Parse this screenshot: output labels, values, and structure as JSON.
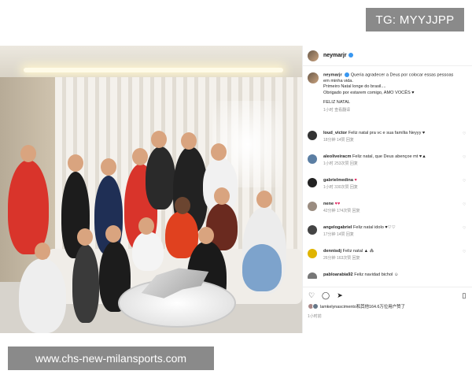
{
  "badges": {
    "tg": "TG: MYYJJPP",
    "watermark": "www.chs-new-milansports.com"
  },
  "post": {
    "username": "neymarjr",
    "caption_user": "neymarjr",
    "caption_lines": [
      "Queria agradecer a Deus por colocar essas pessoas",
      "em minha vida.",
      "Primeiro Natal longe do brasil....",
      "Obrigado por estarem comigo, AMO VOCÊS ♥",
      "",
      "FELIZ NATAL"
    ],
    "caption_meta": "1小时  查看翻译"
  },
  "comments": [
    {
      "user": "loud_victor",
      "text": "Feliz natal pra vc e sua família Neyyy ♥",
      "meta": "18分钟  14赞  回复"
    },
    {
      "user": "aleoliveiracm",
      "text": "Feliz natal, que Deus abençoe mt ♥▲",
      "meta": "1小时  253次赞  回复"
    },
    {
      "user": "gabrielmedina",
      "text": "♥",
      "meta": "1小时  330次赞  回复"
    },
    {
      "user": "nene",
      "text": "♥♥",
      "meta": "42分钟  174次赞  回复"
    },
    {
      "user": "angelogabriel",
      "text": "Feliz natal idolo ♥♡♡",
      "meta": "17分钟  14赞  回复"
    },
    {
      "user": "dennisdj",
      "text": "Feliz natal ▲ ⁂",
      "meta": "26分钟  163次赞  回复"
    },
    {
      "user": "pabloarabia92",
      "text": "Feliz navidad bichol ☺",
      "meta": ""
    }
  ],
  "actions": {
    "icons": [
      "heart-icon",
      "comment-icon",
      "share-icon",
      "bookmark-icon"
    ],
    "likes_text": "lamkelynascimento和其他164.6万位用户赞了",
    "time": "1小时前"
  }
}
